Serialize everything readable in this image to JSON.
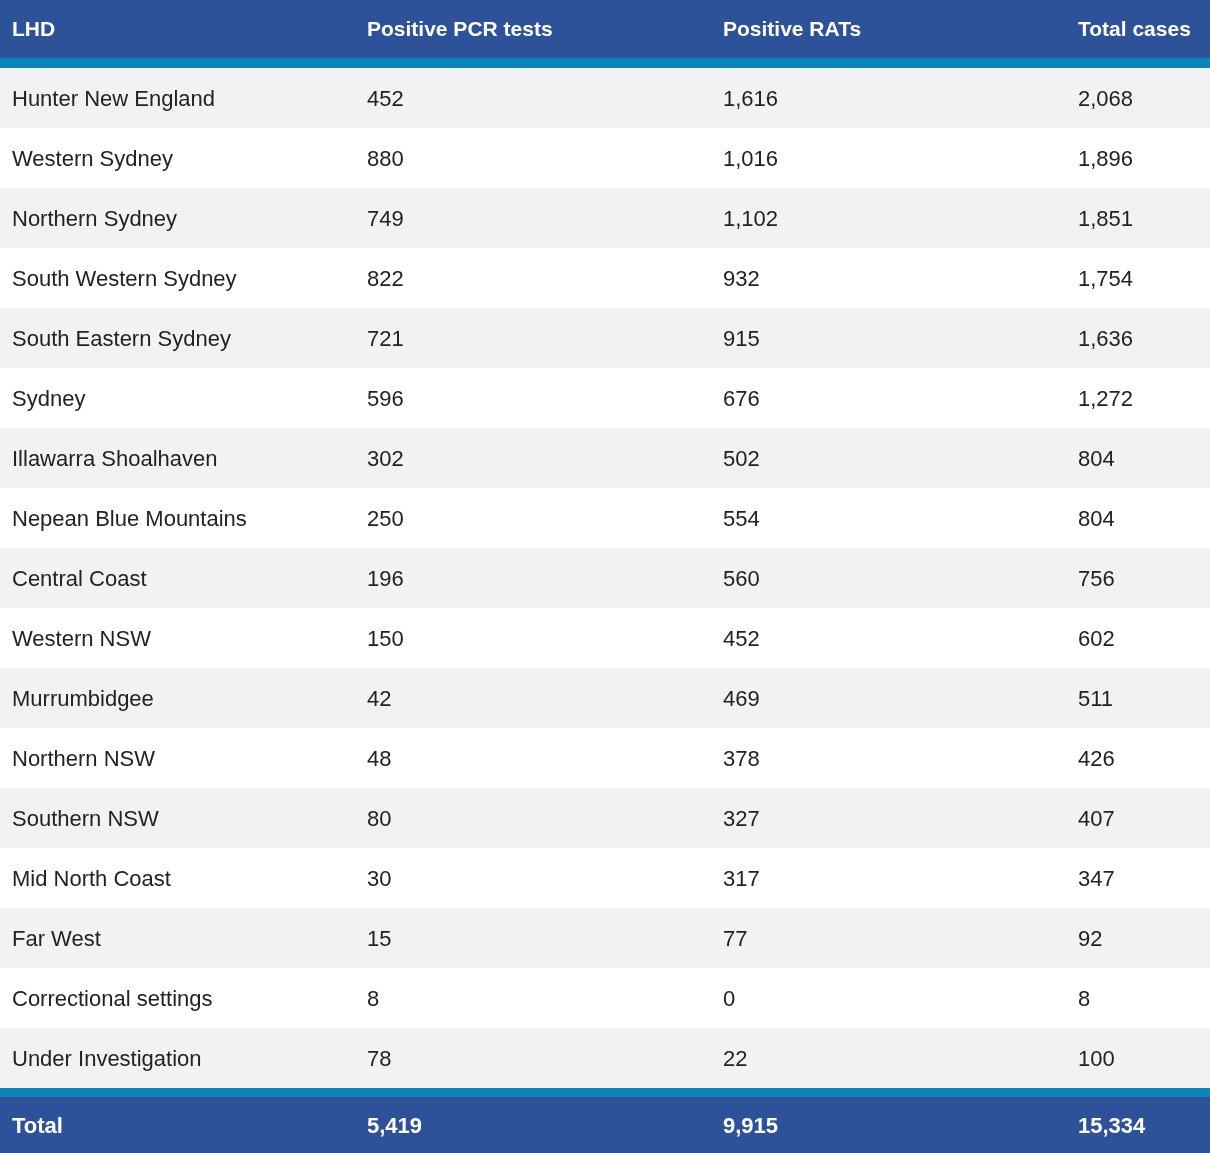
{
  "table": {
    "columns": [
      "LHD",
      "Positive PCR tests",
      "Positive RATs",
      "Total cases"
    ],
    "rows": [
      [
        "Hunter New England",
        "452",
        "1,616",
        "2,068"
      ],
      [
        "Western Sydney",
        "880",
        "1,016",
        "1,896"
      ],
      [
        "Northern Sydney",
        "749",
        "1,102",
        "1,851"
      ],
      [
        "South Western Sydney",
        "822",
        "932",
        "1,754"
      ],
      [
        "South Eastern Sydney",
        "721",
        "915",
        "1,636"
      ],
      [
        "Sydney",
        "596",
        "676",
        "1,272"
      ],
      [
        "Illawarra Shoalhaven",
        "302",
        "502",
        "804"
      ],
      [
        "Nepean Blue Mountains",
        "250",
        "554",
        "804"
      ],
      [
        "Central Coast",
        "196",
        "560",
        "756"
      ],
      [
        "Western NSW",
        "150",
        "452",
        "602"
      ],
      [
        "Murrumbidgee",
        "42",
        "469",
        "511"
      ],
      [
        "Northern NSW",
        "48",
        "378",
        "426"
      ],
      [
        "Southern NSW",
        "80",
        "327",
        "407"
      ],
      [
        "Mid North Coast",
        "30",
        "317",
        "347"
      ],
      [
        "Far West",
        "15",
        "77",
        "92"
      ],
      [
        "Correctional settings",
        "8",
        "0",
        "8"
      ],
      [
        "Under Investigation",
        "78",
        "22",
        "100"
      ]
    ],
    "total": [
      "Total",
      "5,419",
      "9,915",
      "15,334"
    ]
  }
}
